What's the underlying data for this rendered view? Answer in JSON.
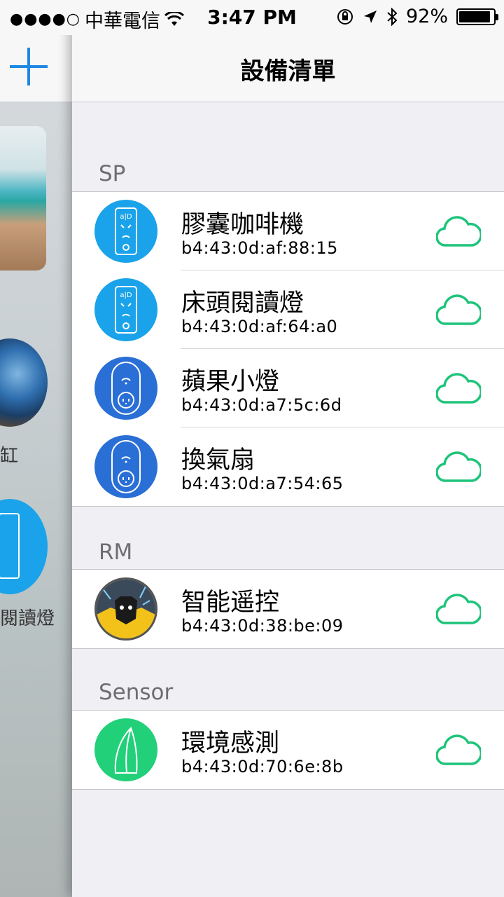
{
  "status_bar": {
    "signal": "●●●●○",
    "carrier": "中華電信",
    "time": "3:47 PM",
    "battery": "92%",
    "battery_level": 0.92
  },
  "drawer": {
    "tank_label": "缸",
    "lamp_label": "閱讀燈"
  },
  "navbar": {
    "title": "設備清單"
  },
  "sections": [
    {
      "header": "SP",
      "devices": [
        {
          "name": "膠囊咖啡機",
          "mac": "b4:43:0d:af:88:15",
          "icon": "sp-mini-plug-icon"
        },
        {
          "name": "床頭閱讀燈",
          "mac": "b4:43:0d:af:64:a0",
          "icon": "sp-mini-plug-icon"
        },
        {
          "name": "蘋果小燈",
          "mac": "b4:43:0d:a7:5c:6d",
          "icon": "sp-round-plug-icon"
        },
        {
          "name": "換氣扇",
          "mac": "b4:43:0d:a7:54:65",
          "icon": "sp-round-plug-icon"
        }
      ]
    },
    {
      "header": "RM",
      "devices": [
        {
          "name": "智能遥控",
          "mac": "b4:43:0d:38:be:09",
          "icon": "rm-remote-icon"
        }
      ]
    },
    {
      "header": "Sensor",
      "devices": [
        {
          "name": "環境感測",
          "mac": "b4:43:0d:70:6e:8b",
          "icon": "sensor-icon"
        }
      ]
    }
  ],
  "colors": {
    "accent": "#1e88e5",
    "cloud": "#1ec47a",
    "sp_light_blue": "#1aa3ea",
    "sp_dark_blue": "#2a6fd6",
    "sensor_green": "#22d07a"
  }
}
